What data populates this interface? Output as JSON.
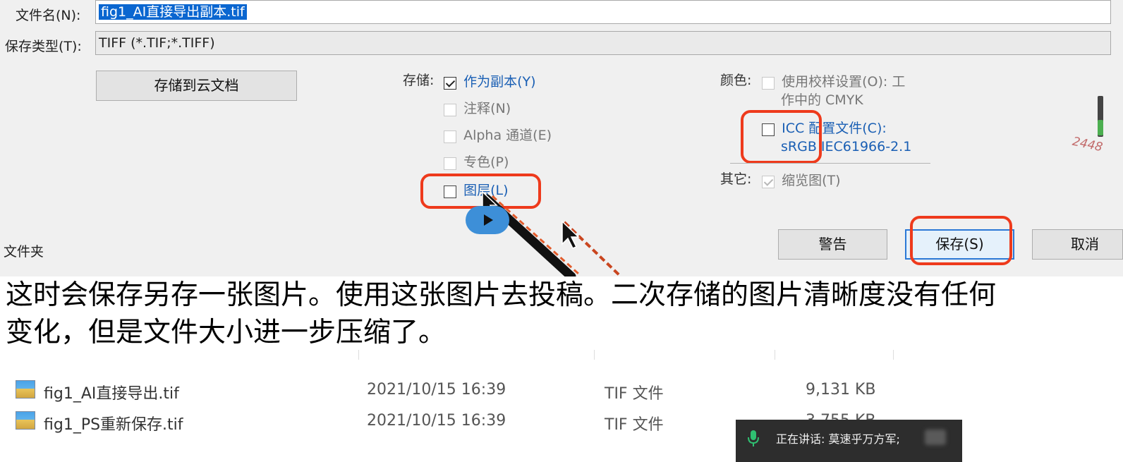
{
  "dialog": {
    "filename_label": "文件名(N):",
    "filename_value": "fig1_AI直接导出副本.tif",
    "type_label": "保存类型(T):",
    "type_value": "TIFF (*.TIF;*.TIFF)",
    "cloud_button": "存储到云文档",
    "folder_label": "文件夹",
    "save_options": {
      "label": "存储:",
      "as_copy": {
        "label": "作为副本(Y)",
        "checked": true
      },
      "notes": {
        "label": "注释(N)",
        "checked": false
      },
      "alpha": {
        "label": "Alpha 通道(E)",
        "checked": false
      },
      "spot": {
        "label": "专色(P)",
        "checked": false
      },
      "layers": {
        "label": "图层(L)",
        "checked": false
      }
    },
    "color_options": {
      "label": "颜色:",
      "proof": {
        "label": "使用校样设置(O): 工",
        "label_line2": "作中的 CMYK",
        "checked": false
      },
      "icc": {
        "label": "ICC 配置文件(C):",
        "label_line2": "sRGB IEC61966-2.1",
        "checked": false
      }
    },
    "other_options": {
      "label": "其它:",
      "thumbnail": {
        "label": "缩览图(T)",
        "checked": true
      }
    },
    "side_number": "2448",
    "buttons": {
      "warning": "警告",
      "save": "保存(S)",
      "cancel": "取消"
    }
  },
  "caption": {
    "line1": "这时会保存另存一张图片。使用这张图片去投稿。二次存储的图片清晰度没有任何",
    "line2": "变化，但是文件大小进一步压缩了。"
  },
  "files": [
    {
      "name": "fig1_AI直接导出.tif",
      "date": "2021/10/15 16:39",
      "type": "TIF 文件",
      "size": "9,131 KB"
    },
    {
      "name": "fig1_PS重新保存.tif",
      "date": "2021/10/15 16:39",
      "type": "TIF 文件",
      "size": "3,755 KB"
    }
  ],
  "voice_overlay": {
    "text": "正在讲话: 莫速乎万方军;"
  },
  "colors": {
    "highlight_red": "#ee3a1c",
    "selection_blue": "#0a66d0",
    "link_blue": "#1a5fb4"
  }
}
